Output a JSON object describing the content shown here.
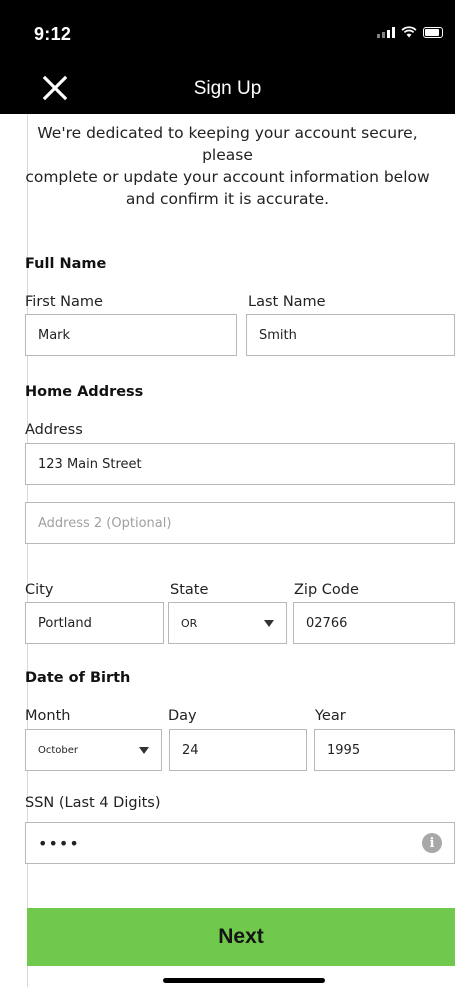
{
  "status_bar": {
    "time": "9:12"
  },
  "nav": {
    "title": "Sign Up"
  },
  "intro": {
    "lines": [
      "We're dedicated to keeping your account secure,",
      "please",
      "complete or update your account information below",
      "and confirm it is accurate."
    ]
  },
  "full_name": {
    "heading": "Full Name",
    "first_label": "First Name",
    "first_value": "Mark",
    "last_label": "Last Name",
    "last_value": "Smith"
  },
  "home_address": {
    "heading": "Home Address",
    "address_label": "Address",
    "address_value": "123 Main Street",
    "address2_placeholder": "Address 2 (Optional)",
    "city_label": "City",
    "city_value": "Portland",
    "state_label": "State",
    "state_value": "OR",
    "zip_label": "Zip Code",
    "zip_value": "02766"
  },
  "dob": {
    "heading": "Date of Birth",
    "month_label": "Month",
    "month_value": "October",
    "day_label": "Day",
    "day_value": "24",
    "year_label": "Year",
    "year_value": "1995"
  },
  "ssn": {
    "label": "SSN (Last 4 Digits)",
    "value": "••••"
  },
  "actions": {
    "next_label": "Next"
  },
  "colors": {
    "accent": "#70c94c",
    "header": "#000000"
  },
  "icons": [
    "close-icon",
    "info-icon",
    "signal-icon",
    "wifi-icon",
    "battery-icon"
  ]
}
